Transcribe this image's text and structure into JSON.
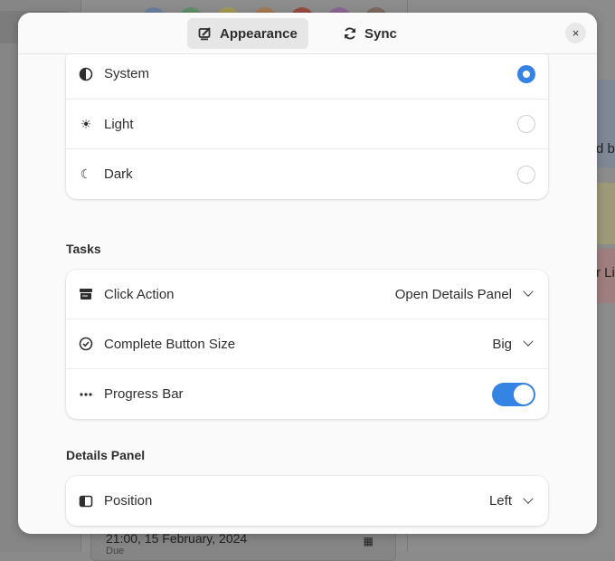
{
  "background": {
    "card_text_1": "d by",
    "card_text_2": "r Li",
    "bottom_card_date": "21:00, 15 February, 2024",
    "bottom_card_label": "Due",
    "colors": [
      "#6a86b2",
      "#5da867",
      "#c9b949",
      "#d6914e",
      "#c24a3e",
      "#a86aba",
      "#8e7361"
    ]
  },
  "dialog": {
    "tabs": [
      {
        "label": "Appearance",
        "icon": "appearance-icon",
        "active": true
      },
      {
        "label": "Sync",
        "icon": "sync-icon",
        "active": false
      }
    ],
    "close_label": "×",
    "theme": {
      "options": [
        {
          "label": "System",
          "icon": "half-circle-icon",
          "selected": true
        },
        {
          "label": "Light",
          "icon": "sun-icon",
          "selected": false
        },
        {
          "label": "Dark",
          "icon": "moon-icon",
          "selected": false
        }
      ]
    },
    "tasks": {
      "title": "Tasks",
      "click_action": {
        "label": "Click Action",
        "value": "Open Details Panel"
      },
      "complete_button_size": {
        "label": "Complete Button Size",
        "value": "Big"
      },
      "progress_bar": {
        "label": "Progress Bar",
        "enabled": true
      }
    },
    "details_panel": {
      "title": "Details Panel",
      "position": {
        "label": "Position",
        "value": "Left"
      }
    },
    "accent": "#3584e4"
  }
}
